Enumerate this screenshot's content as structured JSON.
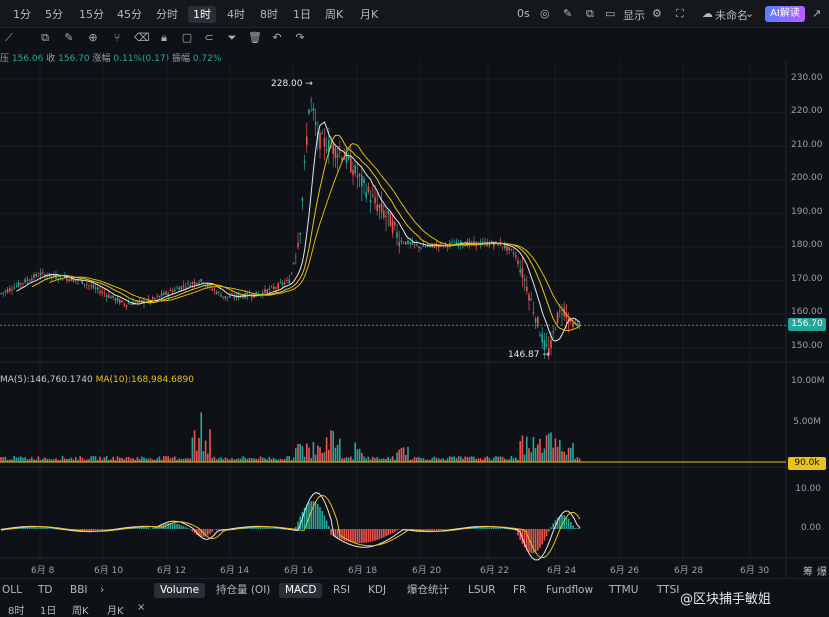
{
  "topbar": {
    "timeframes": [
      "1分",
      "5分",
      "15分",
      "45分",
      "分时",
      "1时",
      "4时",
      "8时",
      "1日",
      "周K",
      "月K"
    ],
    "active_timeframe": "1时",
    "countdown": "0s",
    "display_label": "显示",
    "layout_name": "未命名",
    "ai_button": "AI解读"
  },
  "ohlc": {
    "open_label": "压",
    "open": "156.06",
    "close_label": "收",
    "close": "156.70",
    "change_label": "涨幅",
    "change": "0.11%(0.17)",
    "amp_label": "振幅",
    "amp": "0.72%"
  },
  "price_axis": {
    "ticks": [
      "230.00",
      "220.00",
      "210.00",
      "200.00",
      "190.00",
      "180.00",
      "170.00",
      "160.00",
      "150.00"
    ],
    "current_price": "156.70",
    "high_label": "228.00 →",
    "low_label": "146.87 →"
  },
  "volume": {
    "ma5_label": "MA(5):146,760.1740",
    "ma10_label": "MA(10):168,984.6890",
    "ticks": [
      "10.00M",
      "5.00M"
    ],
    "current": "90.0k"
  },
  "macd_axis": {
    "ticks": [
      "10.00",
      "0.00"
    ]
  },
  "x_axis": {
    "ticks": [
      "6月 8",
      "6月 10",
      "6月 12",
      "6月 14",
      "6月 16",
      "6月 18",
      "6月 20",
      "6月 22",
      "6月 24",
      "6月 26",
      "6月 28",
      "6月 30"
    ]
  },
  "right_edge": {
    "t1": "筹",
    "t2": "爆"
  },
  "indicators": {
    "left": [
      "OLL",
      "TD",
      "BBI"
    ],
    "arrow": "›",
    "main": [
      "Volume",
      "持仓量 (OI)",
      "MACD",
      "RSI",
      "KDJ",
      "爆仓统计",
      "LSUR",
      "FR",
      "Fundflow",
      "TTMU",
      "TTSI"
    ],
    "active": [
      "Volume",
      "MACD"
    ]
  },
  "bottom": {
    "items": [
      "8时",
      "1日",
      "周K",
      "月K"
    ],
    "close": "×"
  },
  "watermark": "@区块捕手敏姐",
  "colors": {
    "up": "#26a69a",
    "down": "#ef5350",
    "ma_white": "#e6e8ec",
    "ma_yellow": "#e9c21a"
  }
}
